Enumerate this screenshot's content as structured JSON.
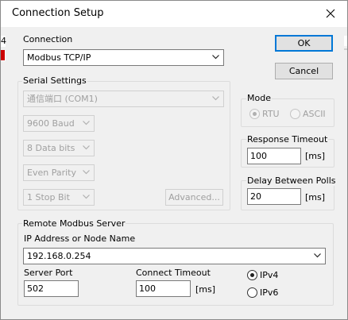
{
  "window": {
    "title": "Connection Setup"
  },
  "behind": {
    "red_char": "4"
  },
  "connection": {
    "group_label": "Connection",
    "value": "Modbus TCP/IP"
  },
  "buttons": {
    "ok": "OK",
    "cancel": "Cancel",
    "advanced": "Advanced..."
  },
  "serial": {
    "group_label": "Serial Settings",
    "port": "通信端口 (COM1)",
    "baud": "9600 Baud",
    "data_bits": "8 Data bits",
    "parity": "Even Parity",
    "stop_bits": "1 Stop Bit"
  },
  "mode": {
    "group_label": "Mode",
    "rtu": "RTU",
    "ascii": "ASCII",
    "selected": "RTU"
  },
  "response_timeout": {
    "group_label": "Response Timeout",
    "value": "100",
    "unit": "[ms]"
  },
  "delay_between_polls": {
    "group_label": "Delay Between Polls",
    "value": "20",
    "unit": "[ms]"
  },
  "remote": {
    "group_label": "Remote Modbus Server",
    "ip_label": "IP Address or Node Name",
    "ip_value": "192.168.0.254",
    "port_label": "Server Port",
    "port_value": "502",
    "connect_timeout_label": "Connect Timeout",
    "connect_timeout_value": "100",
    "connect_timeout_unit": "[ms]",
    "ipv4": "IPv4",
    "ipv6": "IPv6",
    "selected": "IPv4"
  },
  "colors": {
    "accent": "#0078d7",
    "disabled_text": "#a0a0a0",
    "window_bg": "#f0f0f0",
    "behind_red": "#cc0000"
  },
  "icons": {
    "close": "close-icon",
    "dropdown": "chevron-down-icon"
  }
}
